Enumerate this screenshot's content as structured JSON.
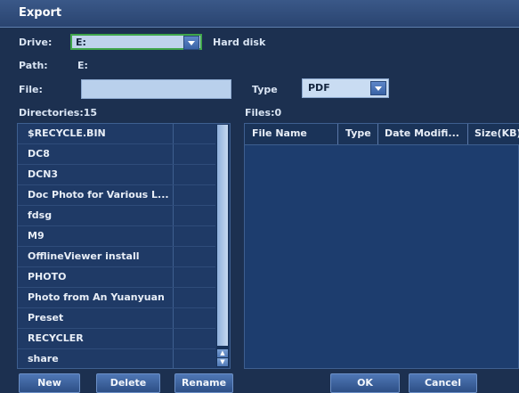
{
  "window": {
    "title": "Export"
  },
  "drive": {
    "label": "Drive:",
    "value": "E:",
    "description": "Hard disk"
  },
  "path": {
    "label": "Path:",
    "value": "E:"
  },
  "file": {
    "label": "File:",
    "value": ""
  },
  "type": {
    "label": "Type",
    "value": "PDF"
  },
  "directories": {
    "label": "Directories:15",
    "items": [
      "$RECYCLE.BIN",
      "DC8",
      "DCN3",
      "Doc Photo for Various L...",
      "fdsg",
      "M9",
      "OfflineViewer install",
      "PHOTO",
      "Photo from An Yuanyuan",
      "Preset",
      "RECYCLER",
      "share"
    ]
  },
  "files": {
    "label": "Files:0",
    "columns": [
      "File Name",
      "Type",
      "Date Modifi...",
      "Size(KB)"
    ],
    "rows": []
  },
  "buttons": {
    "new": "New",
    "delete": "Delete",
    "rename": "Rename",
    "ok": "OK",
    "cancel": "Cancel"
  },
  "colors": {
    "title_bar": "#2f4c7c",
    "panel": "#1f3a66",
    "input": "#b9d0ec",
    "drive_focus_border": "#3fa54a"
  }
}
